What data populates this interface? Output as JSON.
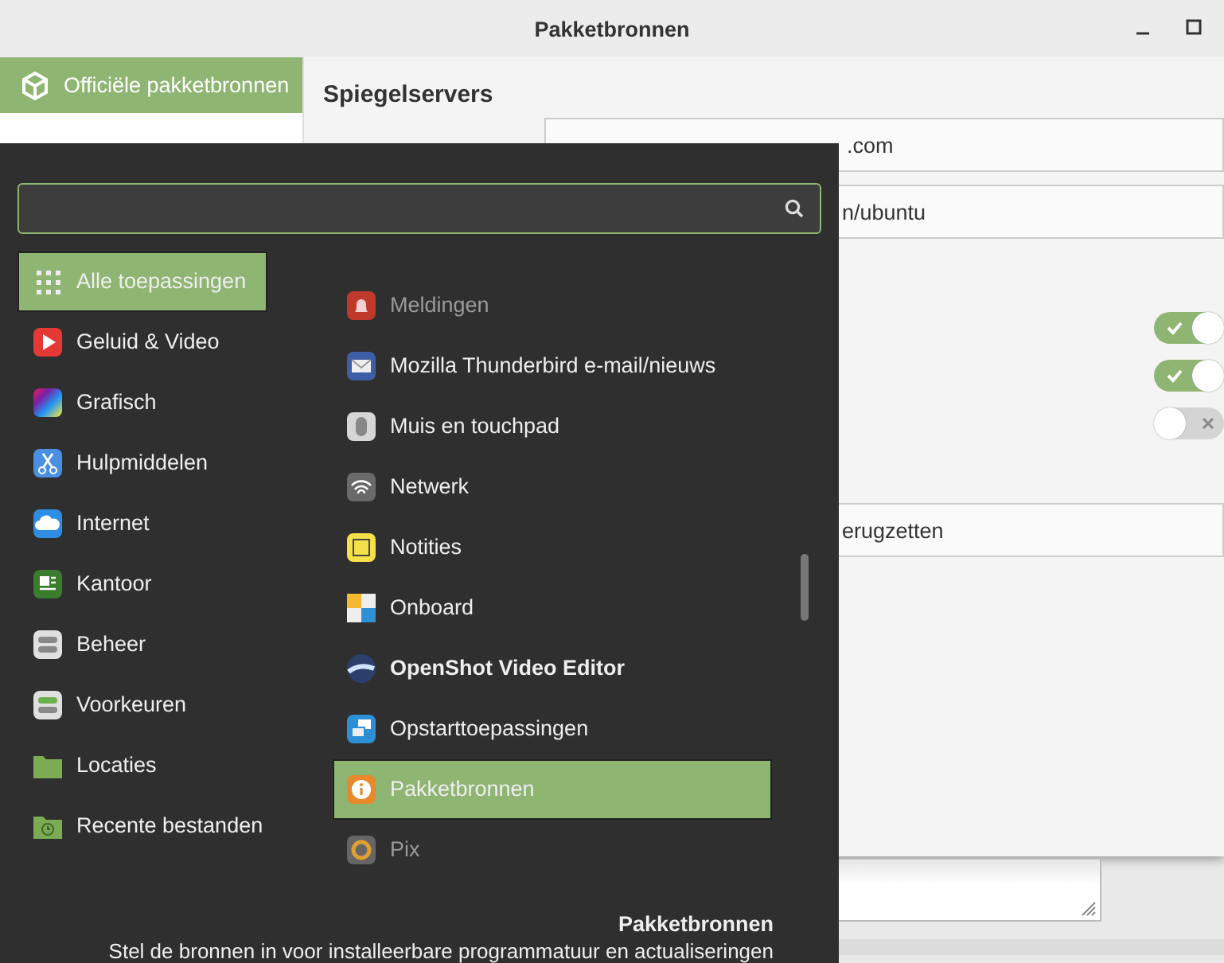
{
  "window": {
    "title": "Pakketbronnen"
  },
  "sidebar": {
    "items": [
      {
        "label": "Officiële pakketbronnen",
        "selected": true
      }
    ]
  },
  "main": {
    "heading": "Spiegelservers",
    "mirror_fields": [
      ".com",
      "n/ubuntu"
    ],
    "toggles": [
      {
        "on": true
      },
      {
        "on": true
      },
      {
        "on": false
      }
    ],
    "reset_button": "erugzetten"
  },
  "menu": {
    "categories": [
      {
        "label": "Alle toepassingen",
        "selected": true
      },
      {
        "label": "Geluid & Video",
        "selected": false
      },
      {
        "label": "Grafisch",
        "selected": false
      },
      {
        "label": "Hulpmiddelen",
        "selected": false
      },
      {
        "label": "Internet",
        "selected": false
      },
      {
        "label": "Kantoor",
        "selected": false
      },
      {
        "label": "Beheer",
        "selected": false
      },
      {
        "label": "Voorkeuren",
        "selected": false
      },
      {
        "label": "Locaties",
        "selected": false
      },
      {
        "label": "Recente bestanden",
        "selected": false
      }
    ],
    "apps": [
      {
        "label": "Meldingen",
        "selected": false,
        "dimmed": true,
        "bold": false
      },
      {
        "label": "Mozilla Thunderbird e-mail/nieuws",
        "selected": false,
        "dimmed": false,
        "bold": false
      },
      {
        "label": "Muis en touchpad",
        "selected": false,
        "dimmed": false,
        "bold": false
      },
      {
        "label": "Netwerk",
        "selected": false,
        "dimmed": false,
        "bold": false
      },
      {
        "label": "Notities",
        "selected": false,
        "dimmed": false,
        "bold": false
      },
      {
        "label": "Onboard",
        "selected": false,
        "dimmed": false,
        "bold": false
      },
      {
        "label": "OpenShot Video Editor",
        "selected": false,
        "dimmed": false,
        "bold": true
      },
      {
        "label": "Opstarttoepassingen",
        "selected": false,
        "dimmed": false,
        "bold": false
      },
      {
        "label": "Pakketbronnen",
        "selected": true,
        "dimmed": false,
        "bold": false
      },
      {
        "label": "Pix",
        "selected": false,
        "dimmed": true,
        "bold": false
      }
    ],
    "footer": {
      "title": "Pakketbronnen",
      "description": "Stel de bronnen in voor installeerbare programmatuur en actualiseringen"
    }
  }
}
